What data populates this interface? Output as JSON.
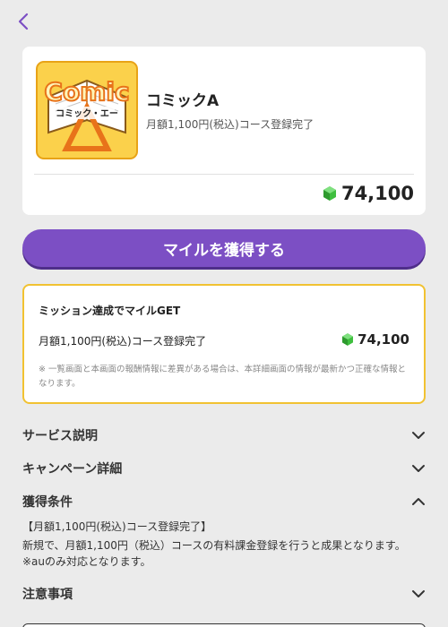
{
  "nav": {
    "back_icon": "chevron-left-icon"
  },
  "service": {
    "logo_text": "Comic",
    "logo_subtext": "コミック・エー",
    "name": "コミックA",
    "condition": "月額1,100円(税込)コース登録完了",
    "points": "74,100"
  },
  "cta": {
    "label": "マイルを獲得する"
  },
  "mission": {
    "title": "ミッション達成でマイルGET",
    "row_label": "月額1,100円(税込)コース登録完了",
    "row_points": "74,100",
    "note": "※ 一覧画面と本画面の報酬情報に差異がある場合は、本詳細画面の情報が最新かつ正確な情報となります。"
  },
  "sections": {
    "service_description": "サービス説明",
    "campaign_details": "キャンペーン詳細",
    "acquisition_conditions": "獲得条件",
    "notes": "注意事項"
  },
  "conditions": {
    "heading": "【月額1,100円(税込)コース登録完了】",
    "line1": "新規で、月額1,100円（税込）コースの有料課金登録を行うと成果となります。",
    "line2": "※auのみ対応となります。"
  },
  "colors": {
    "accent": "#7c4fc4",
    "mission_border": "#f1c232",
    "gem": "#3fbf3f"
  }
}
